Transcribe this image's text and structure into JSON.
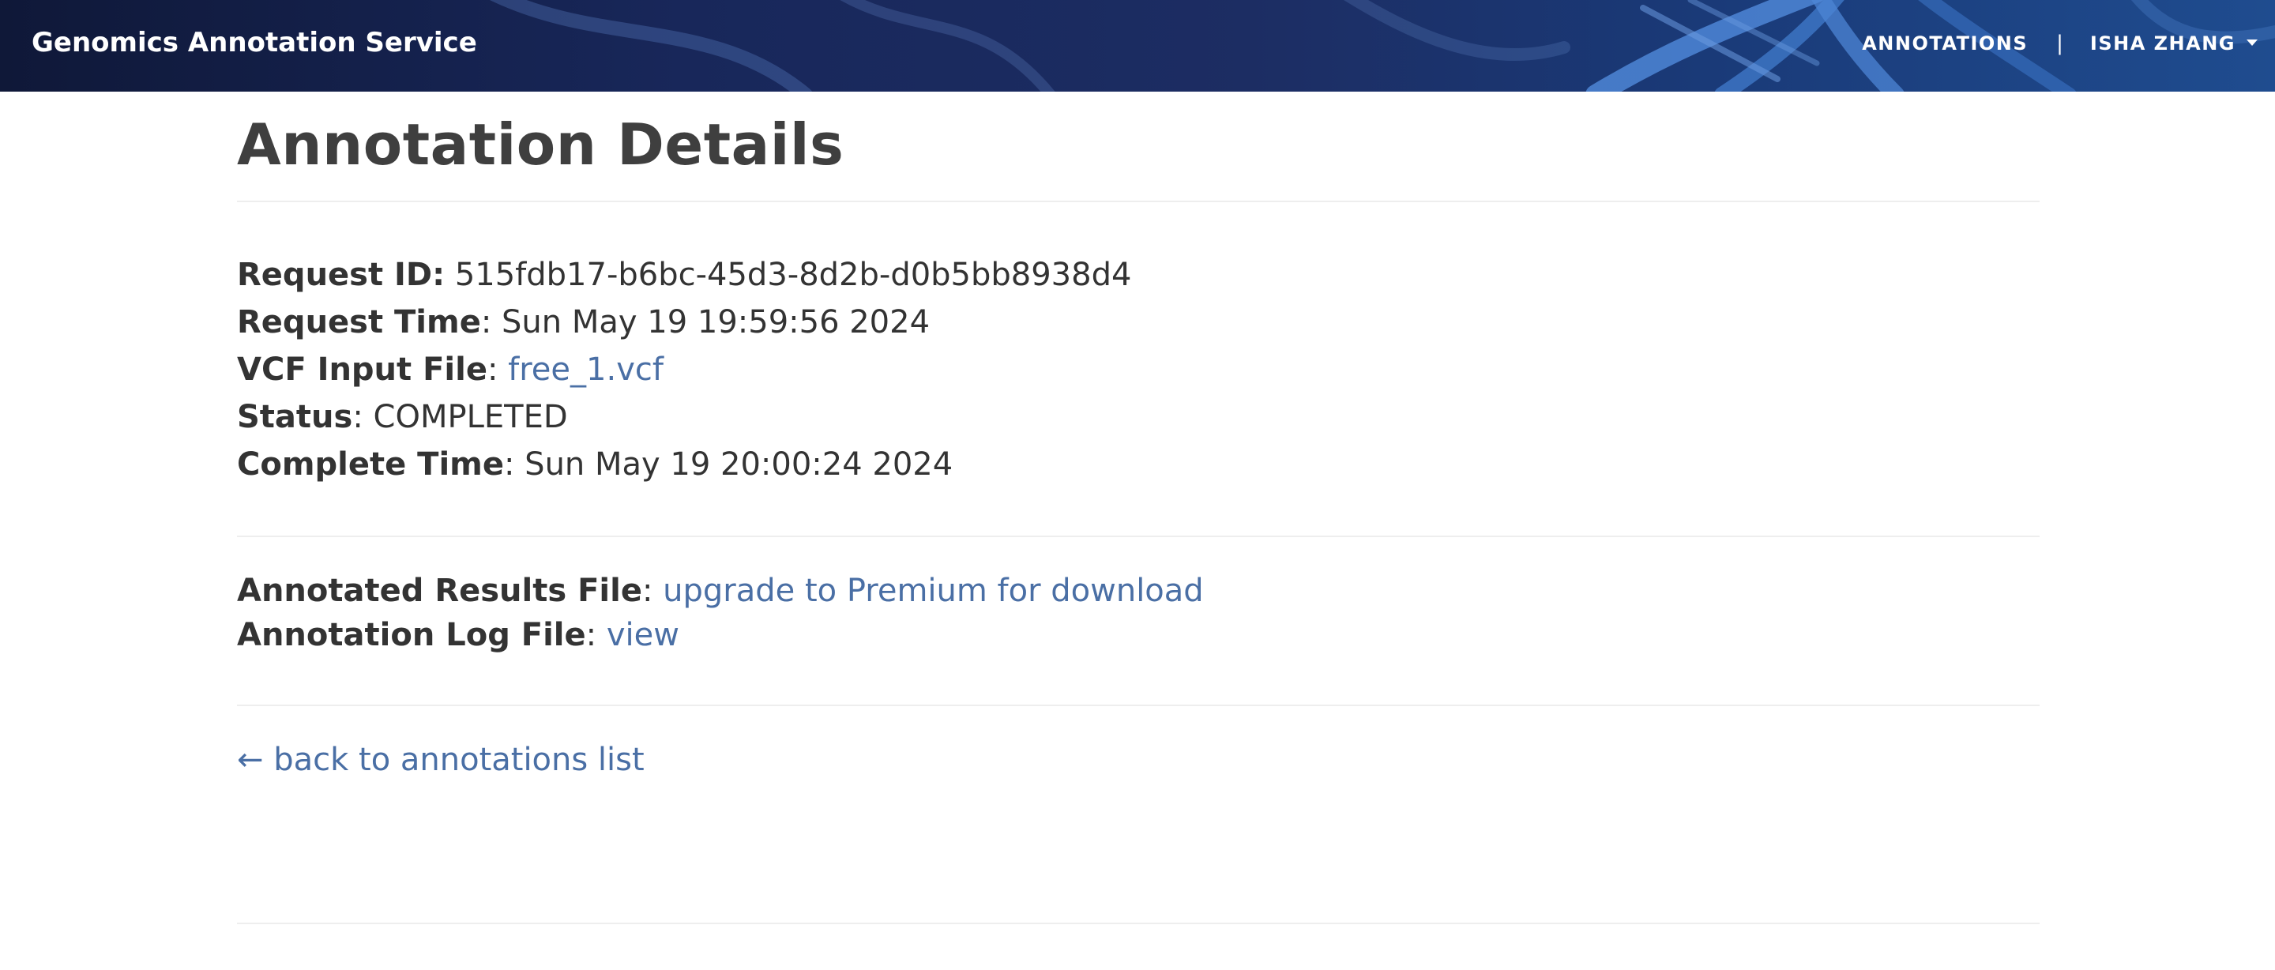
{
  "header": {
    "brand": "Genomics Annotation Service",
    "nav_annotations": "ANNOTATIONS",
    "separator": "|",
    "user_name": "ISHA ZHANG"
  },
  "page": {
    "title": "Annotation Details"
  },
  "details": {
    "request_id_label": "Request ID:",
    "request_id_value": "515fdb17-b6bc-45d3-8d2b-d0b5bb8938d4",
    "request_time_label": "Request Time",
    "request_time_value": "Sun May 19 19:59:56 2024",
    "vcf_label": "VCF Input File",
    "vcf_value": "free_1.vcf",
    "status_label": "Status",
    "status_value": "COMPLETED",
    "complete_time_label": "Complete Time",
    "complete_time_value": "Sun May 19 20:00:24 2024"
  },
  "files": {
    "results_label": "Annotated Results File",
    "results_link": "upgrade to Premium for download",
    "log_label": "Annotation Log File",
    "log_link": "view"
  },
  "back_link": "← back to annotations list",
  "colors": {
    "link": "#4a6fa5",
    "text": "#333333",
    "header_dark": "#18275a"
  }
}
